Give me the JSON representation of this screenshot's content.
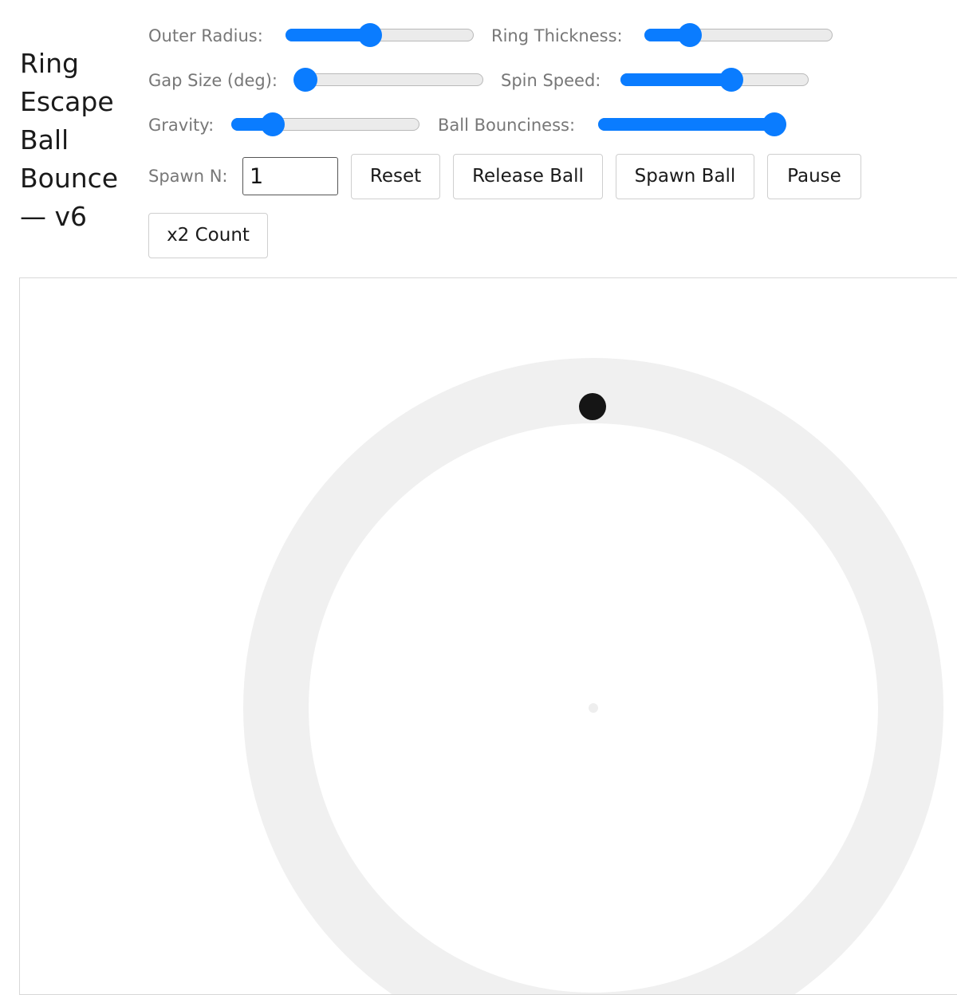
{
  "title": "Ring Escape Ball Bounce — v6",
  "controls": {
    "outer_radius": {
      "label": "Outer Radius:",
      "value": 0.45
    },
    "ring_thickness": {
      "label": "Ring Thickness:",
      "value": 0.24
    },
    "gap_size": {
      "label": "Gap Size (deg):",
      "value": 0.05
    },
    "spin_speed": {
      "label": "Spin Speed:",
      "value": 0.59
    },
    "gravity": {
      "label": "Gravity:",
      "value": 0.22
    },
    "ball_bounciness": {
      "label": "Ball Bounciness:",
      "value": 0.94
    },
    "spawn_n": {
      "label": "Spawn N:",
      "value": "1"
    }
  },
  "buttons": {
    "reset": "Reset",
    "release_ball": "Release Ball",
    "spawn_ball": "Spawn Ball",
    "pause": "Pause",
    "x2_count": "x2 Count"
  },
  "colors": {
    "accent": "#0a7cff",
    "ring": "#f0f0f0",
    "ball": "#151515",
    "center_dot": "#eeeeee"
  }
}
